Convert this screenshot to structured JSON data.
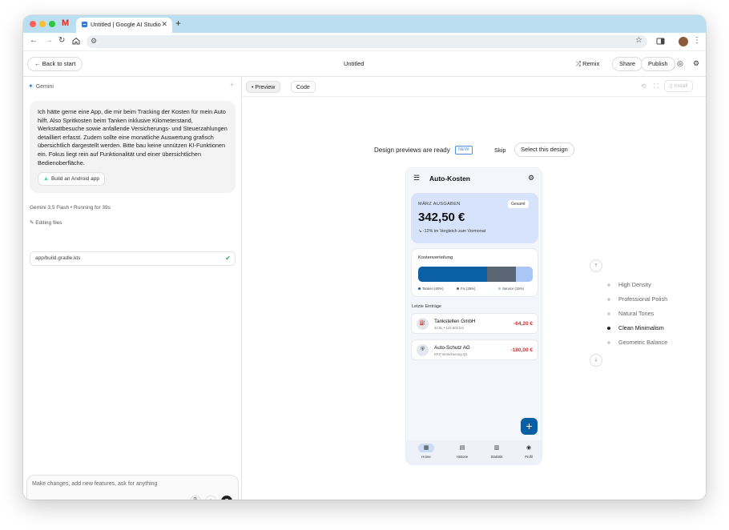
{
  "browser": {
    "tab_title": "Untitled | Google AI Studio",
    "gmail_glyph": "M",
    "new_tab": "+",
    "close": "✕"
  },
  "header": {
    "back_label": "Back to start",
    "title": "Untitled",
    "remix_label": "Remix",
    "share_label": "Share",
    "publish_label": "Publish"
  },
  "chat": {
    "agent_label": "Gemini",
    "user_message": "Ich hätte gerne eine App, die mir beim Tracking der Kosten für mein Auto hilft. Also Spritkosten beim Tanken inklusive Kilometerstand, Werkstattbesuche sowie anfallende Versicherungs- und Steuerzahlungen detailliert erfasst. Zudem sollte eine monatliche Auswertung grafisch übersichtlich dargestellt werden. Bitte bau keine unnützen KI-Funktionen ein. Fokus liegt rein auf Funktionalität und einer übersichtlichen Bedienoberfläche.",
    "chip_label": "Build an Android app",
    "model_status": "Gemini 3.5 Flash  •  Running for 39s",
    "editing_label": "Editing files",
    "file_name": "app/build.gradle.kts",
    "input_placeholder": "Make changes, add new features, ask for anything"
  },
  "preview": {
    "preview_tab": "Preview",
    "code_tab": "Code",
    "install_label": "Install",
    "design_ready": "Design previews are ready",
    "new_badge": "NEW",
    "skip_label": "Skip",
    "select_label": "Select this design"
  },
  "phone": {
    "app_title": "Auto-Kosten",
    "month_label": "MÄRZ AUSGABEN",
    "total": "342,50 €",
    "total_chip": "Gesamt",
    "trend": "-12% im Vergleich zum Vormonat",
    "distribution_title": "Kostenverteilung",
    "distribution": [
      {
        "label": "Tanken (60%)",
        "percent": 60,
        "color": "#0b5fa5"
      },
      {
        "label": "Fix (25%)",
        "percent": 25,
        "color": "#5b6674"
      },
      {
        "label": "Service (15%)",
        "percent": 15,
        "color": "#a9c6f5"
      }
    ],
    "recent_label": "Letzte Einträge",
    "entries": [
      {
        "name": "Tankstellen GmbH",
        "sub": "42,5L • 124.502 km",
        "amount": "-64,20 €",
        "icon": "fuel-icon"
      },
      {
        "name": "Auto-Schutz AG",
        "sub": "KFZ-Versicherung Q1",
        "amount": "-180,00 €",
        "icon": "shield-icon"
      }
    ],
    "nav": [
      "Home",
      "Historie",
      "Statistik",
      "Profil"
    ]
  },
  "styles": {
    "options": [
      "High Density",
      "Professional Polish",
      "Natural Tones",
      "Clean Minimalism",
      "Geometric Balance"
    ],
    "selected": "Clean Minimalism"
  }
}
